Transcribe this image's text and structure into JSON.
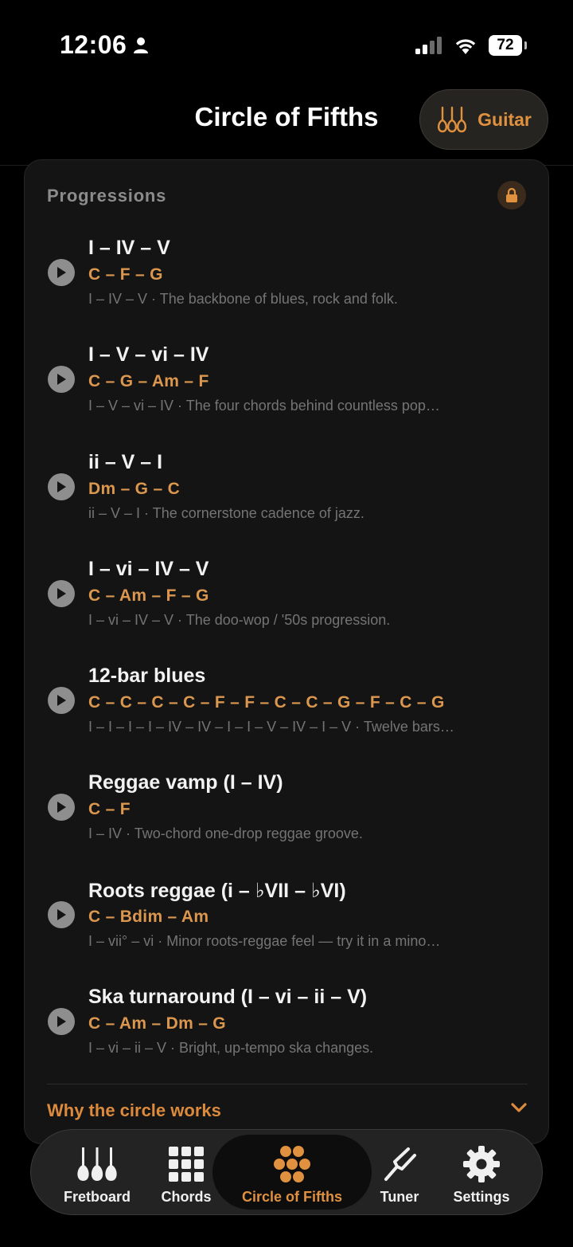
{
  "status_bar": {
    "time": "12:06",
    "battery": "72"
  },
  "header": {
    "title": "Circle of Fifths",
    "instrument_button": "Guitar"
  },
  "progressions": {
    "title": "Progressions",
    "items": [
      {
        "name": "I – IV – V",
        "chords": "C – F – G",
        "desc": "I – IV – V · The backbone of blues, rock and folk."
      },
      {
        "name": "I – V – vi – IV",
        "chords": "C – G – Am – F",
        "desc": "I – V – vi – IV · The four chords behind countless pop…"
      },
      {
        "name": "ii – V – I",
        "chords": "Dm – G – C",
        "desc": "ii – V – I · The cornerstone cadence of jazz."
      },
      {
        "name": "I – vi – IV – V",
        "chords": "C – Am – F – G",
        "desc": "I – vi – IV – V · The doo-wop / '50s progression."
      },
      {
        "name": "12-bar blues",
        "chords": "C – C – C – C – F – F – C – C – G – F – C – G",
        "desc": "I – I – I – I – IV – IV – I – I – V – IV – I – V · Twelve bars…"
      },
      {
        "name": "Reggae vamp (I – IV)",
        "chords": "C – F",
        "desc": "I – IV · Two-chord one-drop reggae groove."
      },
      {
        "name": "Roots reggae (i – ♭VII – ♭VI)",
        "chords": "C – Bdim – Am",
        "desc": "I – vii° – vi · Minor roots-reggae feel — try it in a mino…"
      },
      {
        "name": "Ska turnaround (I – vi – ii – V)",
        "chords": "C – Am – Dm – G",
        "desc": "I – vi – ii – V · Bright, up-tempo ska changes."
      }
    ]
  },
  "why_section": {
    "label": "Why the circle works"
  },
  "tabs": [
    {
      "label": "Fretboard",
      "icon": "guitars-icon"
    },
    {
      "label": "Chords",
      "icon": "grid-icon"
    },
    {
      "label": "Circle of Fifths",
      "icon": "flower-circle-icon",
      "active": true
    },
    {
      "label": "Tuner",
      "icon": "tuning-fork-icon"
    },
    {
      "label": "Settings",
      "icon": "gear-icon"
    }
  ],
  "colors": {
    "accent": "#e0913f",
    "chords": "#dc974e",
    "background": "#000000",
    "card": "#141414"
  }
}
